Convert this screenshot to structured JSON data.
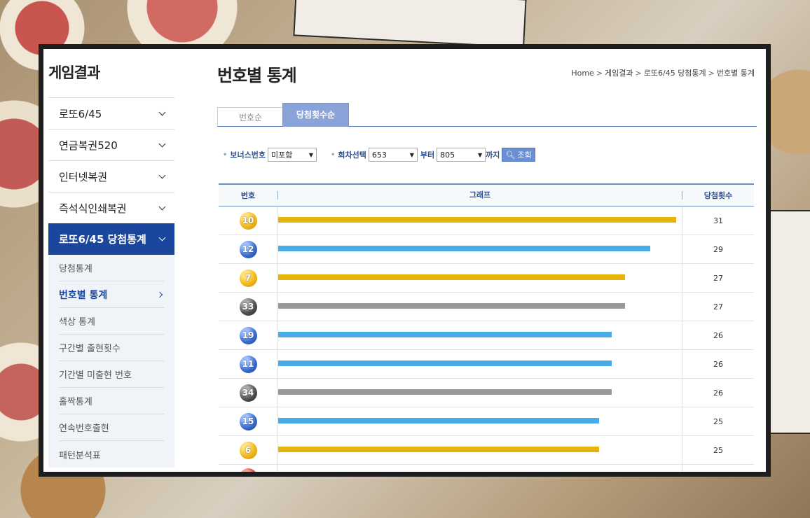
{
  "sidebar": {
    "title": "게임결과",
    "menu": [
      {
        "label": "로또6/45"
      },
      {
        "label": "연금복권520"
      },
      {
        "label": "인터넷복권"
      },
      {
        "label": "즉석식인쇄복권"
      },
      {
        "label": "로또6/45 당첨통계"
      }
    ],
    "submenu": [
      {
        "label": "당첨통계"
      },
      {
        "label": "번호별 통계"
      },
      {
        "label": "색상 통계"
      },
      {
        "label": "구간별 출현횟수"
      },
      {
        "label": "기간별 미출현 번호"
      },
      {
        "label": "홀짝통계"
      },
      {
        "label": "연속번호출현"
      },
      {
        "label": "패턴분석표"
      }
    ]
  },
  "header": {
    "title": "번호별 통계",
    "breadcrumb": [
      "Home",
      "게임결과",
      "로또6/45 당첨통계",
      "번호별 통계"
    ]
  },
  "tabs": [
    {
      "label": "번호순"
    },
    {
      "label": "당첨횟수순"
    }
  ],
  "filters": {
    "bonus_label": "보너스번호",
    "bonus_value": "미포함",
    "round_label": "회차선택",
    "round_from": "653",
    "from_label": "부터",
    "round_to": "805",
    "to_label": "까지",
    "search_label": "조회"
  },
  "table": {
    "headers": [
      "번호",
      "그래프",
      "당첨횟수"
    ],
    "rows": [
      {
        "number": "10",
        "count": "31"
      },
      {
        "number": "12",
        "count": "29"
      },
      {
        "number": "7",
        "count": "27"
      },
      {
        "number": "33",
        "count": "27"
      },
      {
        "number": "19",
        "count": "26"
      },
      {
        "number": "11",
        "count": "26"
      },
      {
        "number": "34",
        "count": "26"
      },
      {
        "number": "15",
        "count": "25"
      },
      {
        "number": "6",
        "count": "25"
      }
    ]
  },
  "colors": {
    "yellow": "#e8b20c",
    "blue": "#4aace6",
    "gray": "#999999",
    "accent": "#1b469e"
  }
}
